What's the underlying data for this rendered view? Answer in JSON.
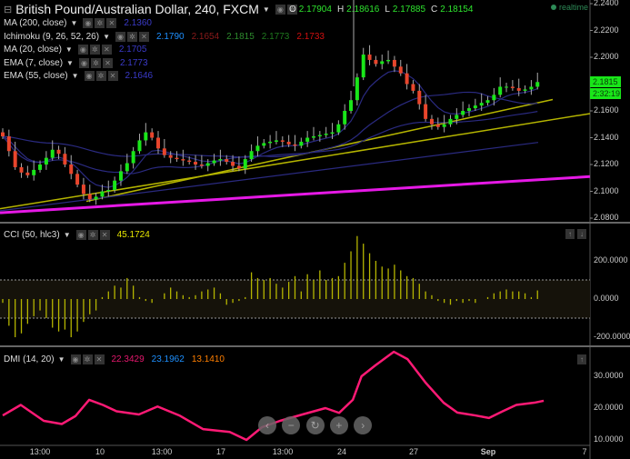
{
  "header": {
    "title": "British Pound/Australian Dollar, 240, FXCM",
    "ohlc": {
      "o_label": "O",
      "o": "2.17904",
      "h_label": "H",
      "h": "2.18616",
      "l_label": "L",
      "l": "2.17885",
      "c_label": "C",
      "c": "2.18154"
    },
    "realtime": "realtime"
  },
  "indicators": [
    {
      "label": "MA (200, close)",
      "values": [
        {
          "v": "2.1360",
          "color": "#3a3ac8"
        }
      ]
    },
    {
      "label": "Ichimoku (9, 26, 52, 26)",
      "values": [
        {
          "v": "2.1790",
          "color": "#1e90ff"
        },
        {
          "v": "2.1654",
          "color": "#8b1a1a"
        },
        {
          "v": "2.1815",
          "color": "#2e8b2e"
        },
        {
          "v": "2.1773",
          "color": "#1f7a1f"
        },
        {
          "v": "2.1733",
          "color": "#d01010"
        }
      ]
    },
    {
      "label": "MA (20, close)",
      "values": [
        {
          "v": "2.1705",
          "color": "#3a3ac8"
        }
      ]
    },
    {
      "label": "EMA (7, close)",
      "values": [
        {
          "v": "2.1773",
          "color": "#3a3ac8"
        }
      ]
    },
    {
      "label": "EMA (55, close)",
      "values": [
        {
          "v": "2.1646",
          "color": "#3a3ac8"
        }
      ]
    }
  ],
  "price_axis": [
    "2.2400",
    "2.2200",
    "2.2000",
    "2.1800",
    "2.1600",
    "2.1400",
    "2.1200",
    "2.1000",
    "2.0800"
  ],
  "price_tag": "2.1815",
  "countdown": "2:32:19",
  "cci": {
    "label": "CCI (50, hlc3)",
    "value": "45.1724",
    "value_color": "#e6e600",
    "axis": [
      "200.0000",
      "0.0000",
      "-200.0000"
    ]
  },
  "dmi": {
    "label": "DMI (14, 20)",
    "values": [
      {
        "v": "22.3429",
        "color": "#e6186e"
      },
      {
        "v": "23.1962",
        "color": "#1e90ff"
      },
      {
        "v": "13.1410",
        "color": "#ff7f00"
      }
    ],
    "axis": [
      "30.0000",
      "20.0000",
      "10.0000"
    ]
  },
  "time_axis": [
    "13:00",
    "10",
    "13:00",
    "17",
    "13:00",
    "24",
    "27",
    "Sep",
    "7"
  ],
  "nav_buttons": [
    "‹",
    "−",
    "↻",
    "+",
    "›"
  ],
  "colors": {
    "up": "#19e619",
    "down": "#e8452c",
    "ma": "#2a2a80",
    "trend": "#b5b500",
    "support": "#e619e6",
    "cci": "#b5b500",
    "dmi": "#ff1a75"
  },
  "chart_data": [
    {
      "type": "candlestick",
      "ylim": [
        2.08,
        2.24
      ],
      "closes": [
        2.141,
        2.13,
        2.118,
        2.114,
        2.112,
        2.116,
        2.12,
        2.125,
        2.131,
        2.128,
        2.12,
        2.113,
        2.105,
        2.098,
        2.094,
        2.096,
        2.1,
        2.101,
        2.108,
        2.115,
        2.121,
        2.13,
        2.138,
        2.144,
        2.14,
        2.132,
        2.127,
        2.125,
        2.124,
        2.123,
        2.122,
        2.12,
        2.119,
        2.121,
        2.123,
        2.124,
        2.122,
        2.119,
        2.117,
        2.124,
        2.13,
        2.134,
        2.136,
        2.137,
        2.138,
        2.137,
        2.135,
        2.134,
        2.137,
        2.14,
        2.141,
        2.142,
        2.143,
        2.144,
        2.15,
        2.16,
        2.168,
        2.185,
        2.202,
        2.198,
        2.195,
        2.197,
        2.198,
        2.193,
        2.188,
        2.18,
        2.175,
        2.165,
        2.154,
        2.15,
        2.148,
        2.15,
        2.154,
        2.157,
        2.16,
        2.162,
        2.164,
        2.166,
        2.168,
        2.172,
        2.178,
        2.178,
        2.177,
        2.175,
        2.176,
        2.178,
        2.1815
      ]
    },
    {
      "type": "bar",
      "name": "CCI",
      "ylim": [
        -280,
        360
      ],
      "bands": [
        -100,
        100
      ],
      "values": [
        -20,
        -140,
        -200,
        -180,
        -130,
        -90,
        -60,
        -100,
        -150,
        -170,
        -160,
        -200,
        -170,
        -120,
        -80,
        -60,
        10,
        40,
        70,
        60,
        110,
        70,
        10,
        -10,
        -20,
        0,
        30,
        60,
        40,
        20,
        10,
        20,
        40,
        50,
        60,
        30,
        -30,
        -20,
        -10,
        10,
        140,
        110,
        100,
        110,
        80,
        60,
        90,
        120,
        40,
        130,
        100,
        150,
        100,
        110,
        120,
        190,
        250,
        330,
        290,
        240,
        200,
        170,
        160,
        180,
        150,
        120,
        110,
        80,
        40,
        20,
        -10,
        -20,
        -30,
        -10,
        -20,
        -10,
        -20,
        0,
        10,
        30,
        40,
        50,
        40,
        40,
        30,
        10,
        45
      ]
    },
    {
      "type": "line",
      "name": "DMI",
      "ylim": [
        8,
        38
      ],
      "bar": [
        0,
        2.9,
        6.6,
        9.5,
        11.7,
        13.9,
        16.1,
        18.3,
        21.9,
        24.9,
        28.5,
        32.2,
        36.5,
        39.2,
        41.7,
        44.6,
        48.2,
        51.9,
        54.1,
        56.3,
        57.7,
        59.9,
        62.9,
        65.1,
        68,
        70.9,
        73.1,
        76,
        78.2,
        80.4,
        82.6,
        85.5,
        87
      ],
      "values": [
        17.7,
        21,
        16,
        15,
        17.5,
        22.6,
        21,
        19,
        18,
        20.5,
        17.6,
        13.4,
        12.5,
        10,
        14,
        16,
        18,
        20,
        18.5,
        22.6,
        30,
        33.4,
        37.7,
        35.4,
        28,
        21.7,
        18.6,
        17.7,
        16.9,
        19,
        21,
        21.7,
        22.3
      ]
    }
  ]
}
